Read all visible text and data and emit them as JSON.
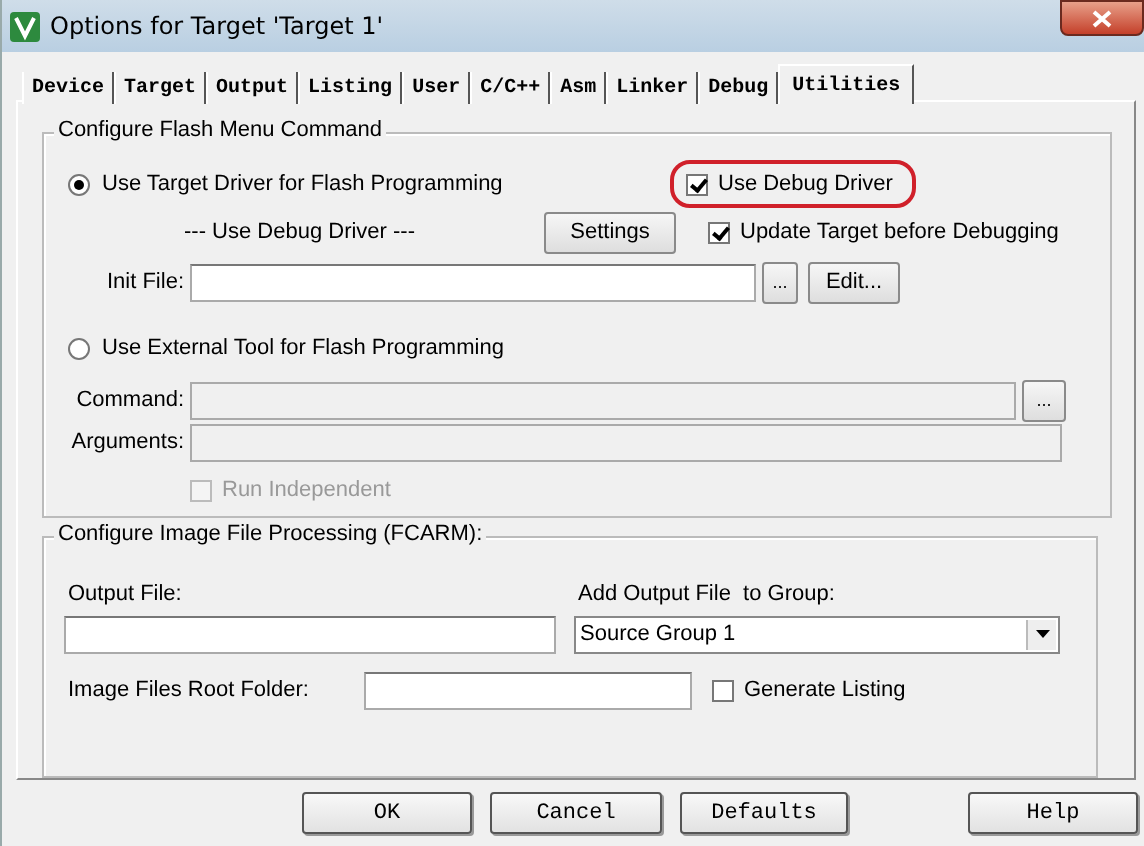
{
  "window": {
    "title": "Options for Target 'Target 1'"
  },
  "tabs": [
    {
      "label": "Device",
      "selected": false
    },
    {
      "label": "Target",
      "selected": false
    },
    {
      "label": "Output",
      "selected": false
    },
    {
      "label": "Listing",
      "selected": false
    },
    {
      "label": "User",
      "selected": false
    },
    {
      "label": "C/C++",
      "selected": false
    },
    {
      "label": "Asm",
      "selected": false
    },
    {
      "label": "Linker",
      "selected": false
    },
    {
      "label": "Debug",
      "selected": false
    },
    {
      "label": "Utilities",
      "selected": true
    }
  ],
  "flash_group": {
    "legend": "Configure Flash Menu Command",
    "target_driver_option": {
      "label": "Use Target Driver for Flash Programming",
      "selected": true
    },
    "use_debug_driver": {
      "label": "Use Debug Driver",
      "checked": true,
      "highlighted": true
    },
    "driver_name": "--- Use Debug Driver ---",
    "settings_button": "Settings",
    "update_target": {
      "label": "Update Target before Debugging",
      "checked": true
    },
    "init_file": {
      "label": "Init File:",
      "browse_button": "...",
      "edit_button": "Edit..."
    },
    "external_tool_option": {
      "label": "Use External Tool for Flash Programming",
      "selected": false
    },
    "command": {
      "label": "Command:",
      "disabled": true,
      "browse_button": "..."
    },
    "arguments": {
      "label": "Arguments:",
      "disabled": true
    },
    "run_independent": {
      "label": "Run Independent",
      "checked": false,
      "disabled": true
    }
  },
  "image_group": {
    "legend": "Configure Image File Processing (FCARM):",
    "output_file": {
      "label": "Output File:"
    },
    "add_to_group": {
      "label": "Add Output File  to Group:",
      "value": "Source Group 1"
    },
    "root_folder": {
      "label": "Image Files Root Folder:"
    },
    "generate_listing": {
      "label": "Generate Listing",
      "checked": false
    }
  },
  "buttons": [
    "OK",
    "Cancel",
    "Defaults",
    "Help"
  ]
}
